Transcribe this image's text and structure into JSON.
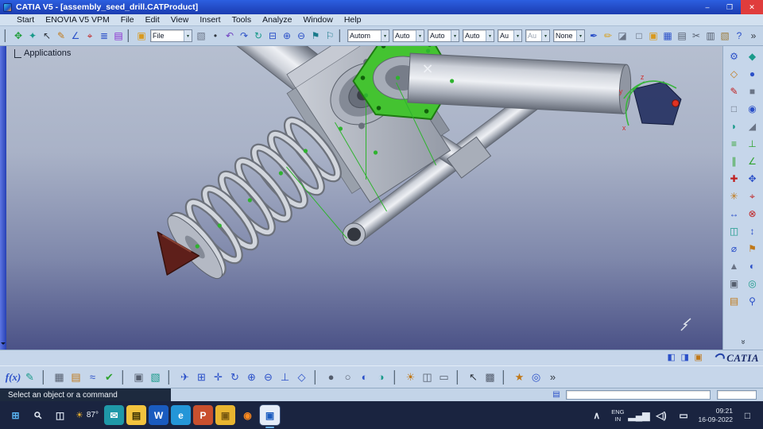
{
  "ui": {
    "dropdown_arrow": "▾"
  },
  "window": {
    "title": "CATIA V5 - [assembly_seed_drill.CATProduct]",
    "minimize_glyph": "–",
    "maximize_glyph": "❐",
    "close_glyph": "✕"
  },
  "menus": [
    "Start",
    "ENOVIA V5 VPM",
    "File",
    "Edit",
    "View",
    "Insert",
    "Tools",
    "Analyze",
    "Window",
    "Help"
  ],
  "toolbar": {
    "group_view": [
      {
        "name": "fly-mode-icon",
        "glyph": "✥",
        "color": "#1f9d3a"
      },
      {
        "name": "compass-icon",
        "glyph": "✦",
        "color": "#199a8a"
      },
      {
        "name": "select-arrow-icon",
        "glyph": "↖",
        "color": "#30363f"
      },
      {
        "name": "pen-icon",
        "glyph": "✎",
        "color": "#c07818"
      },
      {
        "name": "measure-icon",
        "glyph": "∠",
        "color": "#2b50c8"
      },
      {
        "name": "axis-system-icon",
        "glyph": "⌖",
        "color": "#c02020"
      },
      {
        "name": "knowledge-icon",
        "glyph": "≣",
        "color": "#2b50c8"
      },
      {
        "name": "catalog-icon",
        "glyph": "▤",
        "color": "#8a2bd0"
      }
    ],
    "group_std1": [
      {
        "name": "open-folder-icon",
        "glyph": "▣",
        "color": "#d89a20"
      }
    ],
    "file_combo": [
      {
        "name": "file-type-combo",
        "label": "File",
        "size": "wide"
      }
    ],
    "group_edit": [
      {
        "name": "paste-format-icon",
        "glyph": "▧",
        "color": "#6a7486"
      },
      {
        "name": "point-icon",
        "glyph": "•",
        "color": "#30363f"
      },
      {
        "name": "undo-icon",
        "glyph": "↶",
        "color": "#7040c0"
      },
      {
        "name": "redo-icon",
        "glyph": "↷",
        "color": "#2b50c8"
      },
      {
        "name": "update-icon",
        "glyph": "↻",
        "color": "#199a8a"
      },
      {
        "name": "zoom-prev-icon",
        "glyph": "⊟",
        "color": "#2b50c8"
      },
      {
        "name": "zoom-in-tool-icon",
        "glyph": "⊕",
        "color": "#2b50c8"
      },
      {
        "name": "zoom-out-tool-icon",
        "glyph": "⊖",
        "color": "#2b50c8"
      },
      {
        "name": "flag-icon",
        "glyph": "⚑",
        "color": "#1a7a8a"
      },
      {
        "name": "flag-outline-icon",
        "glyph": "⚐",
        "color": "#1a7a8a"
      }
    ],
    "combos": [
      {
        "name": "render-mode-combo",
        "label": "Autom",
        "size": "wide"
      },
      {
        "name": "auto-combo-1",
        "label": "Auto"
      },
      {
        "name": "auto-combo-2",
        "label": "Auto"
      },
      {
        "name": "auto-combo-3",
        "label": "Auto"
      },
      {
        "name": "au-combo-1",
        "label": "Au",
        "size": "narrow"
      },
      {
        "name": "au-combo-2",
        "label": "Au",
        "size": "narrow",
        "disabled": true
      },
      {
        "name": "none-combo",
        "label": "None"
      }
    ],
    "group_style": [
      {
        "name": "pen-style-icon",
        "glyph": "✒",
        "color": "#2b50c8"
      },
      {
        "name": "pencil-style-icon",
        "glyph": "✏",
        "color": "#d8a020"
      },
      {
        "name": "eraser-icon",
        "glyph": "◪",
        "color": "#6a7486"
      }
    ],
    "group_file": [
      {
        "name": "new-document-icon",
        "glyph": "□",
        "color": "#555e6e"
      },
      {
        "name": "open-document-icon",
        "glyph": "▣",
        "color": "#d89a20"
      },
      {
        "name": "save-icon",
        "glyph": "▦",
        "color": "#2b50c8"
      },
      {
        "name": "print-icon",
        "glyph": "▤",
        "color": "#555e6e"
      },
      {
        "name": "cut-icon",
        "glyph": "✂",
        "color": "#555e6e"
      },
      {
        "name": "copy-icon",
        "glyph": "▥",
        "color": "#555e6e"
      },
      {
        "name": "paste-icon",
        "glyph": "▧",
        "color": "#9a7a3a"
      },
      {
        "name": "help-icon",
        "glyph": "?",
        "color": "#2b50c8"
      },
      {
        "name": "toolbar-options-icon",
        "glyph": "»",
        "color": "#30363f"
      }
    ]
  },
  "tree": {
    "root": "Applications"
  },
  "compass": {
    "labels": [
      "x",
      "y",
      "z"
    ]
  },
  "right_toolbar": {
    "more_glyph": "»",
    "icons": [
      {
        "name": "product-structure-icon",
        "glyph": "⚙",
        "color": "#2b50c8"
      },
      {
        "name": "component-icon",
        "glyph": "◆",
        "color": "#1a9a8a"
      },
      {
        "name": "part-icon",
        "glyph": "◇",
        "color": "#c07818"
      },
      {
        "name": "body-icon",
        "glyph": "●",
        "color": "#2b50c8"
      },
      {
        "name": "sketcher-icon",
        "glyph": "✎",
        "color": "#c02020"
      },
      {
        "name": "pad-icon",
        "glyph": "■",
        "color": "#6a7486"
      },
      {
        "name": "pocket-icon",
        "glyph": "□",
        "color": "#6a7486"
      },
      {
        "name": "hole-icon",
        "glyph": "◉",
        "color": "#2b50c8"
      },
      {
        "name": "fillet-icon",
        "glyph": "◗",
        "color": "#1a9a8a"
      },
      {
        "name": "chamfer-icon",
        "glyph": "◢",
        "color": "#6a7486"
      },
      {
        "name": "coincidence-constraint-icon",
        "glyph": "≡",
        "color": "#2fa32f"
      },
      {
        "name": "contact-constraint-icon",
        "glyph": "⊥",
        "color": "#2fa32f"
      },
      {
        "name": "offset-constraint-icon",
        "glyph": "∥",
        "color": "#2fa32f"
      },
      {
        "name": "angle-constraint-icon",
        "glyph": "∠",
        "color": "#2fa32f"
      },
      {
        "name": "fix-component-icon",
        "glyph": "✚",
        "color": "#c02020"
      },
      {
        "name": "smart-move-icon",
        "glyph": "✥",
        "color": "#2b50c8"
      },
      {
        "name": "explode-icon",
        "glyph": "✳",
        "color": "#c07818"
      },
      {
        "name": "snap-icon",
        "glyph": "⌖",
        "color": "#c02020"
      },
      {
        "name": "manipulate-icon",
        "glyph": "↔",
        "color": "#2b50c8"
      },
      {
        "name": "clash-icon",
        "glyph": "⊗",
        "color": "#c02020"
      },
      {
        "name": "sectioning-icon",
        "glyph": "◫",
        "color": "#1a9a8a"
      },
      {
        "name": "distance-icon",
        "glyph": "↕",
        "color": "#2b50c8"
      },
      {
        "name": "measure-between-icon",
        "glyph": "⌀",
        "color": "#2b50c8"
      },
      {
        "name": "annotation-icon",
        "glyph": "⚑",
        "color": "#c07818"
      },
      {
        "name": "weld-feature-icon",
        "glyph": "▲",
        "color": "#6a7486"
      },
      {
        "name": "dmu-review-icon",
        "glyph": "◐",
        "color": "#2b50c8"
      },
      {
        "name": "camera-icon",
        "glyph": "▣",
        "color": "#555e6e"
      },
      {
        "name": "render-icon",
        "glyph": "◎",
        "color": "#1a9a8a"
      },
      {
        "name": "catalog-browser-icon",
        "glyph": "▤",
        "color": "#c07818"
      },
      {
        "name": "search-tool-icon",
        "glyph": "⚲",
        "color": "#2b50c8"
      }
    ]
  },
  "substrip": {
    "icons": [
      {
        "name": "doc-prev-icon",
        "glyph": "◧",
        "color": "#2b50c8"
      },
      {
        "name": "doc-next-icon",
        "glyph": "◨",
        "color": "#2b50c8"
      },
      {
        "name": "window-float-icon",
        "glyph": "▣",
        "color": "#c07818"
      }
    ]
  },
  "brand": {
    "name": "CATIA"
  },
  "bottom_toolbar": {
    "icons": [
      {
        "name": "fx-formula-icon",
        "glyph": "f(x)",
        "color": "#2b50c8",
        "wide": true
      },
      {
        "name": "comment-icon",
        "glyph": "✎",
        "color": "#1a9a8a"
      },
      {
        "sep": true
      },
      {
        "name": "design-table-icon",
        "glyph": "▦",
        "color": "#555e6e"
      },
      {
        "name": "spreadsheet-icon",
        "glyph": "▤",
        "color": "#c07818"
      },
      {
        "name": "law-icon",
        "glyph": "≈",
        "color": "#2b50c8"
      },
      {
        "name": "check-icon",
        "glyph": "✔",
        "color": "#2fa32f"
      },
      {
        "sep": true
      },
      {
        "name": "capture-icon",
        "glyph": "▣",
        "color": "#555e6e"
      },
      {
        "name": "album-icon",
        "glyph": "▧",
        "color": "#1a9a8a"
      },
      {
        "sep": true
      },
      {
        "name": "fly-through-icon",
        "glyph": "✈",
        "color": "#2b50c8"
      },
      {
        "name": "fit-all-icon",
        "glyph": "⊞",
        "color": "#2b50c8"
      },
      {
        "name": "pan-icon",
        "glyph": "✛",
        "color": "#2b50c8"
      },
      {
        "name": "rotate-icon",
        "glyph": "↻",
        "color": "#2b50c8"
      },
      {
        "name": "zoom-in-icon",
        "glyph": "⊕",
        "color": "#2b50c8"
      },
      {
        "name": "zoom-out-icon",
        "glyph": "⊖",
        "color": "#2b50c8"
      },
      {
        "name": "normal-view-icon",
        "glyph": "⊥",
        "color": "#2b50c8"
      },
      {
        "name": "iso-view-icon",
        "glyph": "◇",
        "color": "#2b50c8"
      },
      {
        "sep": true
      },
      {
        "name": "shaded-view-icon",
        "glyph": "●",
        "color": "#555e6e"
      },
      {
        "name": "wireframe-view-icon",
        "glyph": "○",
        "color": "#555e6e"
      },
      {
        "name": "hide-show-icon",
        "glyph": "◐",
        "color": "#2b50c8"
      },
      {
        "name": "swap-space-icon",
        "glyph": "◑",
        "color": "#1a9a8a"
      },
      {
        "sep": true
      },
      {
        "name": "light-icon",
        "glyph": "☀",
        "color": "#c07818"
      },
      {
        "name": "depth-effect-icon",
        "glyph": "◫",
        "color": "#555e6e"
      },
      {
        "name": "ground-icon",
        "glyph": "▭",
        "color": "#555e6e"
      },
      {
        "sep": true
      },
      {
        "name": "select-tool-icon",
        "glyph": "↖",
        "color": "#30363f"
      },
      {
        "name": "selection-sets-icon",
        "glyph": "▩",
        "color": "#555e6e"
      },
      {
        "sep": true
      },
      {
        "name": "star-icon",
        "glyph": "★",
        "color": "#c07818"
      },
      {
        "name": "apply-material-icon",
        "glyph": "◎",
        "color": "#2b50c8"
      },
      {
        "name": "overflow-more-icon",
        "glyph": "»",
        "color": "#30363f"
      }
    ]
  },
  "statusbar": {
    "message": "Select an object or a command",
    "icons": [
      {
        "name": "doc-status-icon",
        "glyph": "▤",
        "color": "#2b50c8"
      }
    ]
  },
  "taskbar": {
    "left_icons": [
      {
        "name": "start-button",
        "glyph": "⊞",
        "color": "#58b2f0"
      },
      {
        "name": "search-button",
        "glyph": "⚲",
        "color": "#dfe6f0"
      },
      {
        "name": "task-view-button",
        "glyph": "◫",
        "color": "#cfd8e6"
      }
    ],
    "weather_icon": "☀",
    "weather_temp": "87°",
    "apps": [
      {
        "name": "mail-app-icon",
        "glyph": "✉",
        "color": "#ffffff",
        "bg": "#1f98a8"
      },
      {
        "name": "file-explorer-icon",
        "glyph": "▤",
        "color": "#3a3000",
        "bg": "#f2c23e"
      },
      {
        "name": "word-app-icon",
        "glyph": "W",
        "color": "#ffffff",
        "bg": "#1a5bbf"
      },
      {
        "name": "edge-app-icon",
        "glyph": "e",
        "color": "#ffffff",
        "bg": "#2496d8"
      },
      {
        "name": "powerpoint-app-icon",
        "glyph": "P",
        "color": "#ffffff",
        "bg": "#c9502e"
      },
      {
        "name": "media-folder-icon",
        "glyph": "▣",
        "color": "#7a5a10",
        "bg": "#e8b530"
      },
      {
        "name": "firefox-app-icon",
        "glyph": "◉",
        "color": "#ff8a1e"
      },
      {
        "name": "catia-app-icon",
        "glyph": "▣",
        "color": "#1a5bbf",
        "bg": "#e4ecf8",
        "active": true
      }
    ],
    "tray_icons": [
      {
        "name": "tray-chevron-icon",
        "glyph": "∧",
        "color": "#dfe6f0"
      }
    ],
    "lang_line1": "ENG",
    "lang_line2": "IN",
    "status_icons": [
      {
        "name": "network-icon",
        "glyph": "▂▄▆",
        "color": "#dfe6f0"
      },
      {
        "name": "volume-icon",
        "glyph": "◁)",
        "color": "#dfe6f0"
      },
      {
        "name": "battery-icon",
        "glyph": "▭",
        "color": "#dfe6f0"
      }
    ],
    "time": "09:21",
    "date": "16-09-2022",
    "corner_icons": [
      {
        "name": "notification-icon",
        "glyph": "□",
        "color": "#dfe6f0"
      }
    ]
  }
}
